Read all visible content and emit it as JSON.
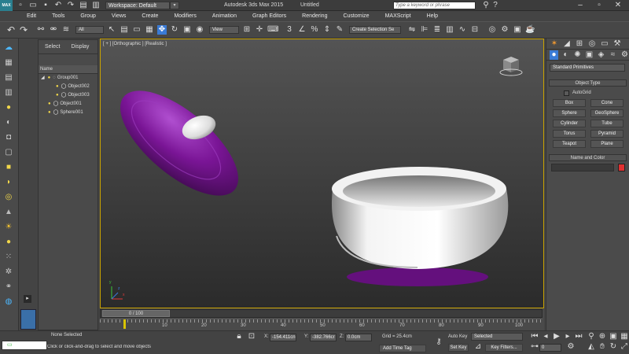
{
  "title_bar": {
    "workspace": "Workspace: Default",
    "app_title": "Autodesk 3ds Max 2015",
    "doc_title": "Untitled",
    "search_placeholder": "Type a keyword or phrase",
    "app_icon": "MAX"
  },
  "menu": [
    "Edit",
    "Tools",
    "Group",
    "Views",
    "Create",
    "Modifiers",
    "Animation",
    "Graph Editors",
    "Rendering",
    "Customize",
    "MAXScript",
    "Help"
  ],
  "toolbar": {
    "selection_filter": "All",
    "ref_coord": "View",
    "named_selection": "Create Selection Se"
  },
  "explorer": {
    "tabs": [
      "Select",
      "Display"
    ],
    "column_header": "Name",
    "items": [
      {
        "label": "Group001",
        "indent": 0
      },
      {
        "label": "Object002",
        "indent": 2
      },
      {
        "label": "Object003",
        "indent": 2
      },
      {
        "label": "Object001",
        "indent": 1
      },
      {
        "label": "Sphere001",
        "indent": 1
      }
    ]
  },
  "viewport": {
    "label": "[ + ] [Orthographic ] [Realistic ]",
    "axis_x": "x",
    "axis_y": "y",
    "axis_z": "z"
  },
  "command_panel": {
    "dropdown": "Standard Primitives",
    "object_type_header": "Object Type",
    "autogrid": "AutoGrid",
    "buttons": [
      "Box",
      "Cone",
      "Sphere",
      "GeoSphere",
      "Cylinder",
      "Tube",
      "Torus",
      "Pyramid",
      "Teapot",
      "Plane"
    ],
    "name_color_header": "Name and Color",
    "color_swatch": "#e03030"
  },
  "timeline": {
    "frame_label": "0 / 100",
    "ticks": [
      "10",
      "20",
      "30",
      "40",
      "50",
      "60",
      "70",
      "80",
      "90",
      "100"
    ]
  },
  "status": {
    "selected": "None Selected",
    "prompt": "Click or click-and-drag to select and move objects",
    "x_label": "X:",
    "x_value": "-154.411cn",
    "y_label": "Y:",
    "y_value": "-382.766cr",
    "z_label": "Z:",
    "z_value": "0.0cm",
    "grid": "Grid = 25.4cm",
    "add_time_tag": "Add Time Tag",
    "auto_key": "Auto Key",
    "set_key": "Set Key",
    "key_mode": "Selected",
    "key_filters": "Key Filters...",
    "frame_value": "0"
  },
  "colors": {
    "accent_viewport_border": "#c8a200",
    "object_purple": "#7a1596",
    "selected_tool": "#3a7bd5"
  }
}
